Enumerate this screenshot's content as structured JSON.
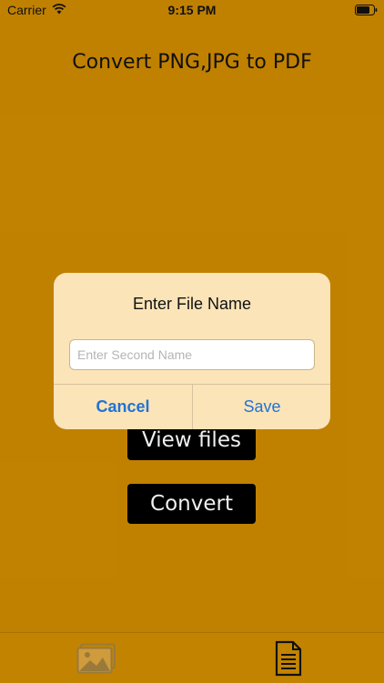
{
  "status_bar": {
    "carrier": "Carrier",
    "time": "9:15 PM",
    "wifi_icon": "wifi-icon",
    "battery_icon": "battery-icon"
  },
  "main": {
    "title": "Convert PNG,JPG to PDF",
    "view_files_label": "View files",
    "convert_label": "Convert"
  },
  "alert": {
    "title": "Enter File Name",
    "input_placeholder": "Enter Second Name",
    "input_value": "",
    "cancel_label": "Cancel",
    "save_label": "Save"
  },
  "tab_bar": {
    "items": [
      {
        "icon": "images-icon",
        "selected": false
      },
      {
        "icon": "document-icon",
        "selected": true
      }
    ]
  },
  "colors": {
    "background": "#cc8a00",
    "alert_background": "#fbe4b8",
    "button_background": "#000000",
    "accent_blue": "#1f73d6",
    "tab_bar_background": "#c28400"
  }
}
